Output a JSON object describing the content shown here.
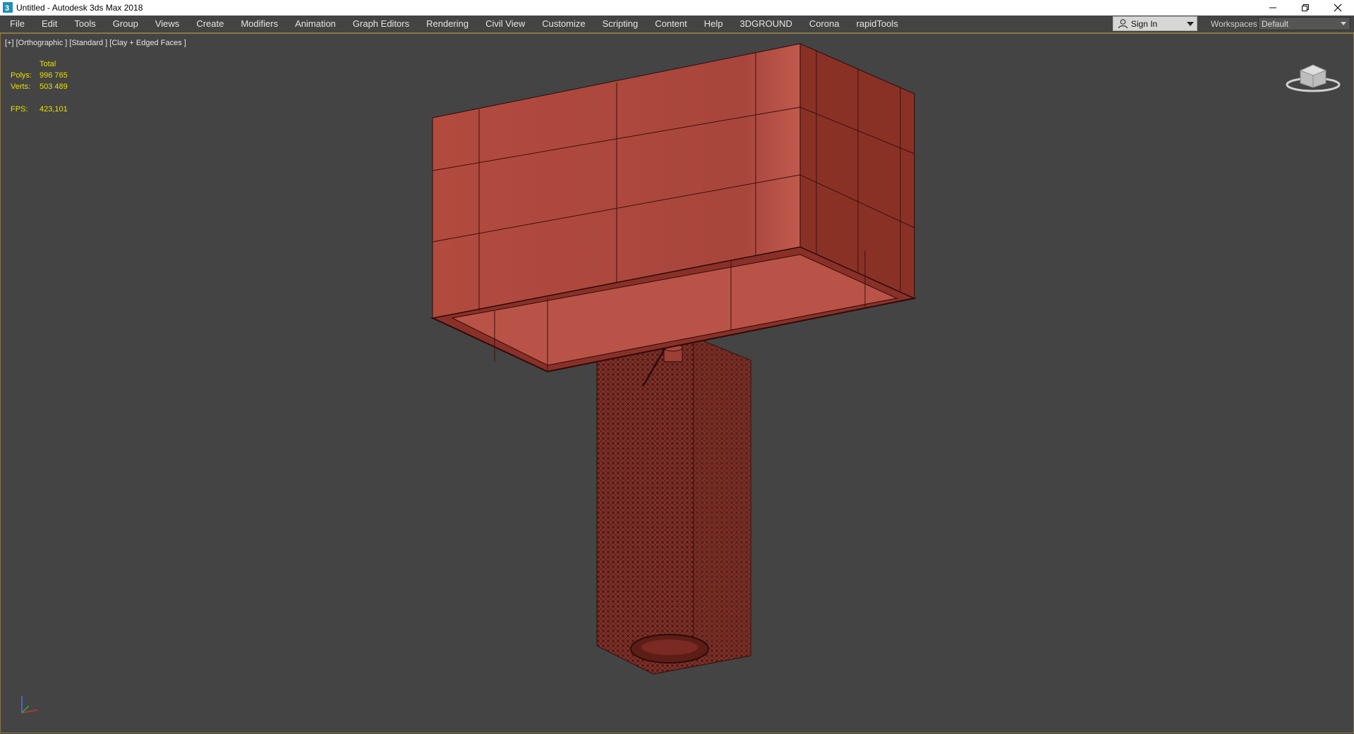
{
  "window": {
    "title": "Untitled - Autodesk 3ds Max 2018",
    "controls": [
      "minimize-icon",
      "restore-icon",
      "close-icon"
    ]
  },
  "menubar": {
    "items": [
      "File",
      "Edit",
      "Tools",
      "Group",
      "Views",
      "Create",
      "Modifiers",
      "Animation",
      "Graph Editors",
      "Rendering",
      "Civil View",
      "Customize",
      "Scripting",
      "Content",
      "Help",
      "3DGROUND",
      "Corona",
      "rapidTools"
    ]
  },
  "signin": {
    "label": "Sign In",
    "icon": "user-icon"
  },
  "workspaces": {
    "label": "Workspaces:",
    "value": "Default"
  },
  "viewport": {
    "label": "[+] [Orthographic ] [Standard ] [Clay + Edged Faces ]",
    "stats": {
      "header": "Total",
      "polys_label": "Polys:",
      "polys": "996 765",
      "verts_label": "Verts:",
      "verts": "503 489",
      "fps_label": "FPS:",
      "fps": "423,101"
    }
  },
  "colors": {
    "viewport_bg": "#444444",
    "stats_text": "#e8e000",
    "model_clay": "#a8463c",
    "accent_border": "#8a7740"
  }
}
